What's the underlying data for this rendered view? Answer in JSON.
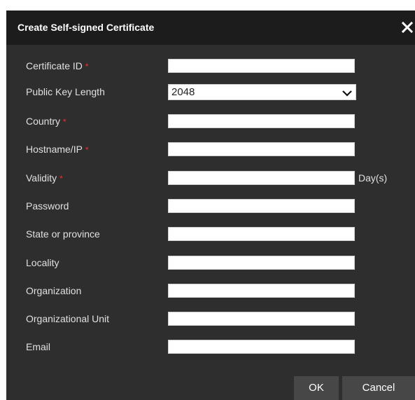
{
  "dialog": {
    "title": "Create Self-signed Certificate",
    "close_icon": "close-icon"
  },
  "fields": [
    {
      "label": "Certificate ID",
      "required": "*",
      "value": ""
    },
    {
      "label": "Public Key Length",
      "value": "2048"
    },
    {
      "label": "Country",
      "required": "*",
      "value": ""
    },
    {
      "label": "Hostname/IP",
      "required": "*",
      "value": ""
    },
    {
      "label": "Validity",
      "required": "*",
      "value": "",
      "unit": "Day(s)"
    },
    {
      "label": "Password",
      "value": ""
    },
    {
      "label": "State or province",
      "value": ""
    },
    {
      "label": "Locality",
      "value": ""
    },
    {
      "label": "Organization",
      "value": ""
    },
    {
      "label": "Organizational Unit",
      "value": ""
    },
    {
      "label": "Email",
      "value": ""
    }
  ],
  "buttons": {
    "ok_label": "OK",
    "cancel_label": "Cancel"
  },
  "colors": {
    "dialog_bg": "#2e2e2e",
    "titlebar_bg": "#1c1c1c",
    "required_mark": "#ff2a2a",
    "button_bg": "#474747"
  }
}
